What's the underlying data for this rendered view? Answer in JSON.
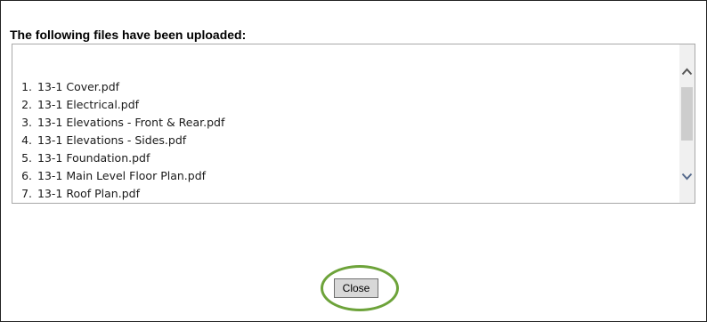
{
  "dialog": {
    "heading": "The following files have been uploaded:",
    "files": [
      {
        "num": "1.",
        "name": "13-1 Cover.pdf"
      },
      {
        "num": "2.",
        "name": "13-1 Electrical.pdf"
      },
      {
        "num": "3.",
        "name": "13-1 Elevations - Front & Rear.pdf"
      },
      {
        "num": "4.",
        "name": "13-1 Elevations - Sides.pdf"
      },
      {
        "num": "5.",
        "name": "13-1 Foundation.pdf"
      },
      {
        "num": "6.",
        "name": "13-1 Main Level Floor Plan.pdf"
      },
      {
        "num": "7.",
        "name": "13-1 Roof Plan.pdf"
      }
    ],
    "close_label": "Close",
    "highlight_color": "#6da33a",
    "icons": {
      "scroll_up": "chevron-up-icon",
      "scroll_down": "chevron-down-icon"
    }
  }
}
